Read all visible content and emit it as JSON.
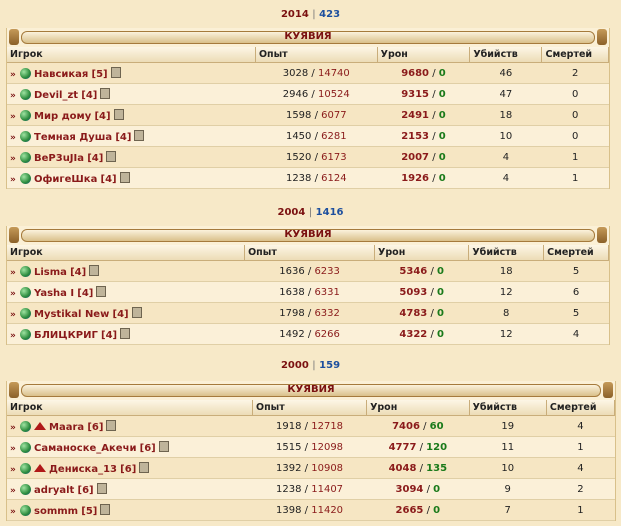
{
  "sep": "|",
  "battles": [
    {
      "score_a": "2014",
      "score_b": "423",
      "clan": "КУЯВИЯ",
      "headers": [
        "Игрок",
        "Опыт",
        "Урон",
        "Убийств",
        "Смертей"
      ],
      "rows": [
        {
          "name": "Навсикая",
          "level": "[5]",
          "exp": "3028",
          "exp_total": "14740",
          "dmg": "9680",
          "dmg2": "0",
          "kills": "46",
          "deaths": "2",
          "icon": "globe-icon"
        },
        {
          "name": "Devil_zt",
          "level": "[4]",
          "exp": "2946",
          "exp_total": "10524",
          "dmg": "9315",
          "dmg2": "0",
          "kills": "47",
          "deaths": "0",
          "icon": "globe-icon"
        },
        {
          "name": "Мир дому",
          "level": "[4]",
          "exp": "1598",
          "exp_total": "6077",
          "dmg": "2491",
          "dmg2": "0",
          "kills": "18",
          "deaths": "0",
          "icon": "globe-icon"
        },
        {
          "name": "Темная Душа",
          "level": "[4]",
          "exp": "1450",
          "exp_total": "6281",
          "dmg": "2153",
          "dmg2": "0",
          "kills": "10",
          "deaths": "0",
          "icon": "globe-icon"
        },
        {
          "name": "ВеР3uJIa",
          "level": "[4]",
          "exp": "1520",
          "exp_total": "6173",
          "dmg": "2007",
          "dmg2": "0",
          "kills": "4",
          "deaths": "1",
          "icon": "globe-icon"
        },
        {
          "name": "ОфигеШка",
          "level": "[4]",
          "exp": "1238",
          "exp_total": "6124",
          "dmg": "1926",
          "dmg2": "0",
          "kills": "4",
          "deaths": "1",
          "icon": "globe-icon"
        }
      ]
    },
    {
      "score_a": "2004",
      "score_b": "1416",
      "clan": "КУЯВИЯ",
      "headers": [
        "Игрок",
        "Опыт",
        "Урон",
        "Убийств",
        "Смертей"
      ],
      "rows": [
        {
          "name": "Lisma",
          "level": "[4]",
          "exp": "1636",
          "exp_total": "6233",
          "dmg": "5346",
          "dmg2": "0",
          "kills": "18",
          "deaths": "5",
          "icon": "globe-icon"
        },
        {
          "name": "Yasha I",
          "level": "[4]",
          "exp": "1638",
          "exp_total": "6331",
          "dmg": "5093",
          "dmg2": "0",
          "kills": "12",
          "deaths": "6",
          "icon": "globe-icon"
        },
        {
          "name": "Mystikal New",
          "level": "[4]",
          "exp": "1798",
          "exp_total": "6332",
          "dmg": "4783",
          "dmg2": "0",
          "kills": "8",
          "deaths": "5",
          "icon": "globe-icon"
        },
        {
          "name": "БЛИЦКРИГ",
          "level": "[4]",
          "exp": "1492",
          "exp_total": "6266",
          "dmg": "4322",
          "dmg2": "0",
          "kills": "12",
          "deaths": "4",
          "icon": "globe-icon"
        }
      ]
    },
    {
      "score_a": "2000",
      "score_b": "159",
      "clan": "КУЯВИЯ",
      "headers": [
        "Игрок",
        "Опыт",
        "Урон",
        "Убийств",
        "Смертей"
      ],
      "rows": [
        {
          "name": "Maara",
          "level": "[6]",
          "exp": "1918",
          "exp_total": "12718",
          "dmg": "7406",
          "dmg2": "60",
          "kills": "19",
          "deaths": "4",
          "icon": "rank-icon"
        },
        {
          "name": "Саманоске_Акечи",
          "level": "[6]",
          "exp": "1515",
          "exp_total": "12098",
          "dmg": "4777",
          "dmg2": "120",
          "kills": "11",
          "deaths": "1",
          "icon": "globe-icon"
        },
        {
          "name": "Дениска_13",
          "level": "[6]",
          "exp": "1392",
          "exp_total": "10908",
          "dmg": "4048",
          "dmg2": "135",
          "kills": "10",
          "deaths": "4",
          "icon": "rank-icon"
        },
        {
          "name": "adryalt",
          "level": "[6]",
          "exp": "1238",
          "exp_total": "11407",
          "dmg": "3094",
          "dmg2": "0",
          "kills": "9",
          "deaths": "2",
          "icon": "globe-icon"
        },
        {
          "name": "sommm",
          "level": "[5]",
          "exp": "1398",
          "exp_total": "11420",
          "dmg": "2665",
          "dmg2": "0",
          "kills": "7",
          "deaths": "1",
          "icon": "globe-icon"
        }
      ]
    }
  ]
}
